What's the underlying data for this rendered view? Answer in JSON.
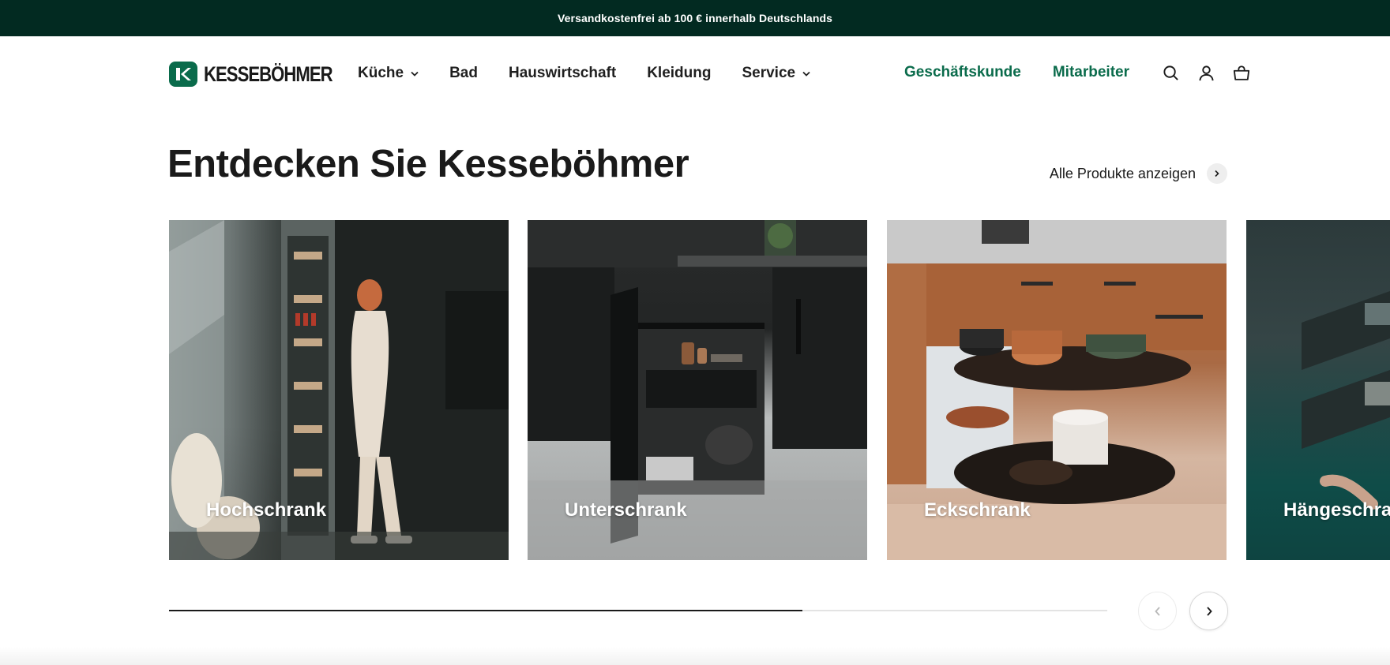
{
  "announcement": {
    "text": "Versandkostenfrei ab 100 € innerhalb Deutschlands"
  },
  "brand": {
    "name": "KESSEBÖHMER",
    "accent": "#0a6b4b",
    "announcement_bg": "#022a21"
  },
  "nav": {
    "items": [
      {
        "label": "Küche",
        "has_dropdown": true
      },
      {
        "label": "Bad",
        "has_dropdown": false
      },
      {
        "label": "Hauswirtschaft",
        "has_dropdown": false
      },
      {
        "label": "Kleidung",
        "has_dropdown": false
      },
      {
        "label": "Service",
        "has_dropdown": true
      }
    ],
    "right_links": [
      "Geschäftskunde",
      "Mitarbeiter"
    ],
    "icons": [
      "search-icon",
      "account-icon",
      "cart-icon"
    ]
  },
  "section": {
    "title": "Entdecken Sie Kesseböhmer",
    "view_all_label": "Alle Produkte anzeigen"
  },
  "categories": [
    {
      "label": "Hochschrank"
    },
    {
      "label": "Unterschrank"
    },
    {
      "label": "Eckschrank"
    },
    {
      "label": "Hängeschrank"
    }
  ],
  "carousel": {
    "progress": 0.675
  }
}
